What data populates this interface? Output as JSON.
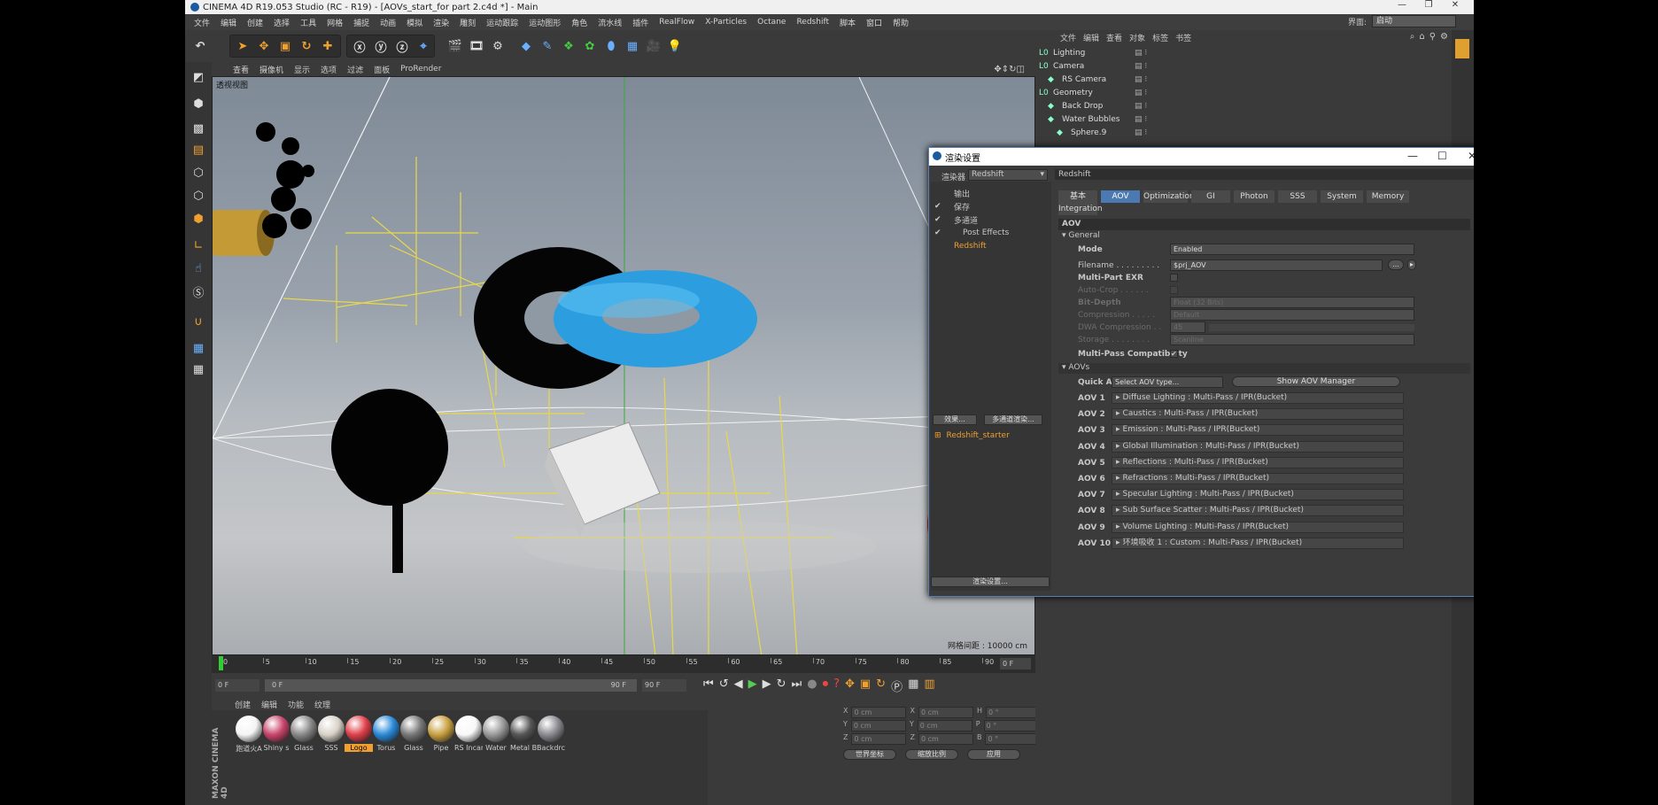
{
  "window": {
    "title": "CINEMA 4D R19.053 Studio (RC - R19) - [AOVs_start_for part 2.c4d *] - Main",
    "controls": [
      "—",
      "❐",
      "✕"
    ]
  },
  "menubar": [
    "文件",
    "编辑",
    "创建",
    "选择",
    "工具",
    "网格",
    "捕捉",
    "动画",
    "模拟",
    "渲染",
    "雕刻",
    "运动跟踪",
    "运动图形",
    "角色",
    "流水线",
    "插件",
    "RealFlow",
    "X-Particles",
    "Octane",
    "Redshift",
    "脚本",
    "窗口",
    "帮助"
  ],
  "layout": {
    "label": "界面:",
    "value": "启动"
  },
  "viewport": {
    "menu": [
      "查看",
      "摄像机",
      "显示",
      "选项",
      "过滤",
      "面板",
      "ProRender"
    ],
    "label": "透视视图",
    "grid": "网格间距 : 10000 cm"
  },
  "timeline": {
    "ticks": [
      "0",
      "5",
      "10",
      "15",
      "20",
      "25",
      "30",
      "35",
      "40",
      "45",
      "50",
      "55",
      "60",
      "65",
      "70",
      "75",
      "80",
      "85",
      "90"
    ],
    "current": "0 F"
  },
  "playbar": {
    "start": "0 F",
    "slider_start": "0 F",
    "slider_end": "90 F",
    "end": "90 F"
  },
  "materials": {
    "menu": [
      "创建",
      "编辑",
      "功能",
      "纹理"
    ],
    "items": [
      {
        "name": "跑道火A",
        "color": "#f4f4f4"
      },
      {
        "name": "Shiny s",
        "color": "#c8456a"
      },
      {
        "name": "Glass",
        "color": "#888"
      },
      {
        "name": "SSS",
        "color": "#d8d2c8"
      },
      {
        "name": "Logo",
        "color": "#e0404a",
        "selected": true
      },
      {
        "name": "Torus",
        "color": "#2a8ad8"
      },
      {
        "name": "Glass",
        "color": "#777"
      },
      {
        "name": "Pipe",
        "color": "#c8a040"
      },
      {
        "name": "RS Incar",
        "color": "#f8f8f8"
      },
      {
        "name": "Water",
        "color": "#999"
      },
      {
        "name": "Metal B",
        "color": "#555"
      },
      {
        "name": "Backdrc",
        "color": "#8a8a90"
      }
    ]
  },
  "coords": {
    "rows": [
      [
        "X",
        "0 cm",
        "X",
        "0 cm",
        "H",
        "0 °"
      ],
      [
        "Y",
        "0 cm",
        "Y",
        "0 cm",
        "P",
        "0 °"
      ],
      [
        "Z",
        "0 cm",
        "Z",
        "0 cm",
        "B",
        "0 °"
      ]
    ],
    "mode1": "世界坐标",
    "mode2": "缩放比例",
    "apply": "应用"
  },
  "objects": {
    "menu": [
      "文件",
      "编辑",
      "查看",
      "对象",
      "标签",
      "书签"
    ],
    "rows": [
      {
        "name": "Lighting",
        "indent": 0
      },
      {
        "name": "Camera",
        "indent": 0
      },
      {
        "name": "RS Camera",
        "indent": 1
      },
      {
        "name": "Geometry",
        "indent": 0
      },
      {
        "name": "Back Drop",
        "indent": 1
      },
      {
        "name": "Water Bubbles",
        "indent": 1
      },
      {
        "name": "Sphere.9",
        "indent": 2
      }
    ]
  },
  "dialog": {
    "title": "渲染设置",
    "renderer_label": "渲染器",
    "renderer": "Redshift",
    "left_items": [
      {
        "label": "输出",
        "check": false,
        "indent": 1
      },
      {
        "label": "保存",
        "check": true,
        "indent": 1
      },
      {
        "label": "多通道",
        "check": true,
        "indent": 1
      },
      {
        "label": "Post Effects",
        "check": true,
        "indent": 2
      },
      {
        "label": "Redshift",
        "check": false,
        "indent": 1,
        "active": true
      }
    ],
    "effects_btn": "效果...",
    "multipass_btn": "多通道渲染...",
    "preset": "Redshift_starter",
    "render_settings_btn": "渲染设置...",
    "header": "Redshift",
    "tabs": [
      "基本",
      "AOV",
      "Optimization",
      "GI",
      "Photon",
      "SSS",
      "System",
      "Memory",
      "Integration"
    ],
    "active_tab": "AOV",
    "aov_title": "AOV",
    "general": "General",
    "props": [
      {
        "label": "Mode",
        "value": "Enabled",
        "dim": false,
        "bold": true
      },
      {
        "label": "Filename . . . . . . . . .",
        "value": "$prj_AOV",
        "dim": false,
        "bold": false
      },
      {
        "label": "Multi-Part EXR",
        "value": "",
        "dim": false,
        "bold": true
      },
      {
        "label": "Auto-Crop . . . . . .",
        "value": "",
        "dim": true,
        "bold": false
      },
      {
        "label": "Bit-Depth",
        "value": "Float (32 Bits)",
        "dim": true,
        "bold": true
      },
      {
        "label": "Compression . . . . .",
        "value": "Default",
        "dim": true,
        "bold": false
      },
      {
        "label": "DWA Compression . .",
        "value": "45",
        "dim": true,
        "bold": false
      },
      {
        "label": "Storage . . . . . . . .",
        "value": "Scanline",
        "dim": true,
        "bold": false
      },
      {
        "label": "Multi-Pass Compatibility",
        "value": "✔",
        "dim": false,
        "bold": true
      }
    ],
    "aovs_title": "AOVs",
    "quick_add": "Quick Add",
    "quick_add_value": "Select AOV type...",
    "show_manager": "Show AOV Manager",
    "aovs": [
      {
        "id": "AOV 1",
        "text": "Diffuse Lighting : Multi-Pass / IPR(Bucket)"
      },
      {
        "id": "AOV 2",
        "text": "Caustics : Multi-Pass / IPR(Bucket)"
      },
      {
        "id": "AOV 3",
        "text": "Emission : Multi-Pass / IPR(Bucket)"
      },
      {
        "id": "AOV 4",
        "text": "Global Illumination : Multi-Pass / IPR(Bucket)"
      },
      {
        "id": "AOV 5",
        "text": "Reflections : Multi-Pass / IPR(Bucket)"
      },
      {
        "id": "AOV 6",
        "text": "Refractions : Multi-Pass / IPR(Bucket)"
      },
      {
        "id": "AOV 7",
        "text": "Specular Lighting : Multi-Pass / IPR(Bucket)"
      },
      {
        "id": "AOV 8",
        "text": "Sub Surface Scatter : Multi-Pass / IPR(Bucket)"
      },
      {
        "id": "AOV 9",
        "text": "Volume Lighting : Multi-Pass / IPR(Bucket)"
      },
      {
        "id": "AOV 10",
        "text": "环境吸收 1 : Custom : Multi-Pass / IPR(Bucket)"
      }
    ]
  },
  "brand": "MAXON CINEMA 4D"
}
